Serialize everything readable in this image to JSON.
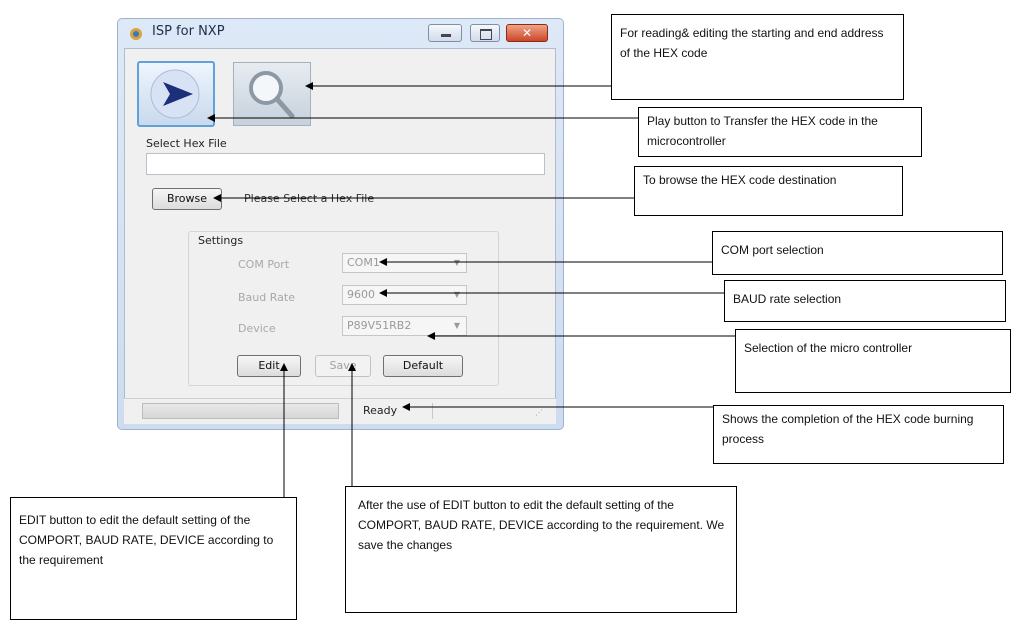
{
  "window": {
    "title": "ISP for NXP",
    "select_hex_label": "Select Hex File",
    "hex_file_value": "",
    "browse_label": "Browse",
    "browse_status": "Please Select a Hex File",
    "settings_label": "Settings",
    "com_port_label": "COM Port",
    "com_port_value": "COM1",
    "baud_rate_label": "Baud Rate",
    "baud_rate_value": "9600",
    "device_label": "Device",
    "device_value": "P89V51RB2",
    "edit_label": "Edit",
    "save_label": "Save",
    "default_label": "Default",
    "status_text": "Ready"
  },
  "annotations": {
    "address_note": "For reading& editing the starting and end address of the HEX code",
    "play_note": "Play button to Transfer the HEX code in the microcontroller",
    "browse_note": "To browse the HEX code destination",
    "com_note": "COM port selection",
    "baud_note": "BAUD rate selection",
    "device_note": "Selection of the micro controller",
    "status_note": "Shows the completion of the HEX code burning process",
    "edit_note": "EDIT button to edit the default setting of the COMPORT, BAUD RATE, DEVICE according to the requirement",
    "save_note": "After the use of EDIT button to edit the default setting of the COMPORT, BAUD RATE, DEVICE according to the requirement.  We save the changes"
  },
  "icons": {
    "play": "play-arrow-icon",
    "search": "magnifier-icon",
    "minimize": "minimize-icon",
    "maximize": "maximize-icon",
    "close": "close-icon"
  }
}
